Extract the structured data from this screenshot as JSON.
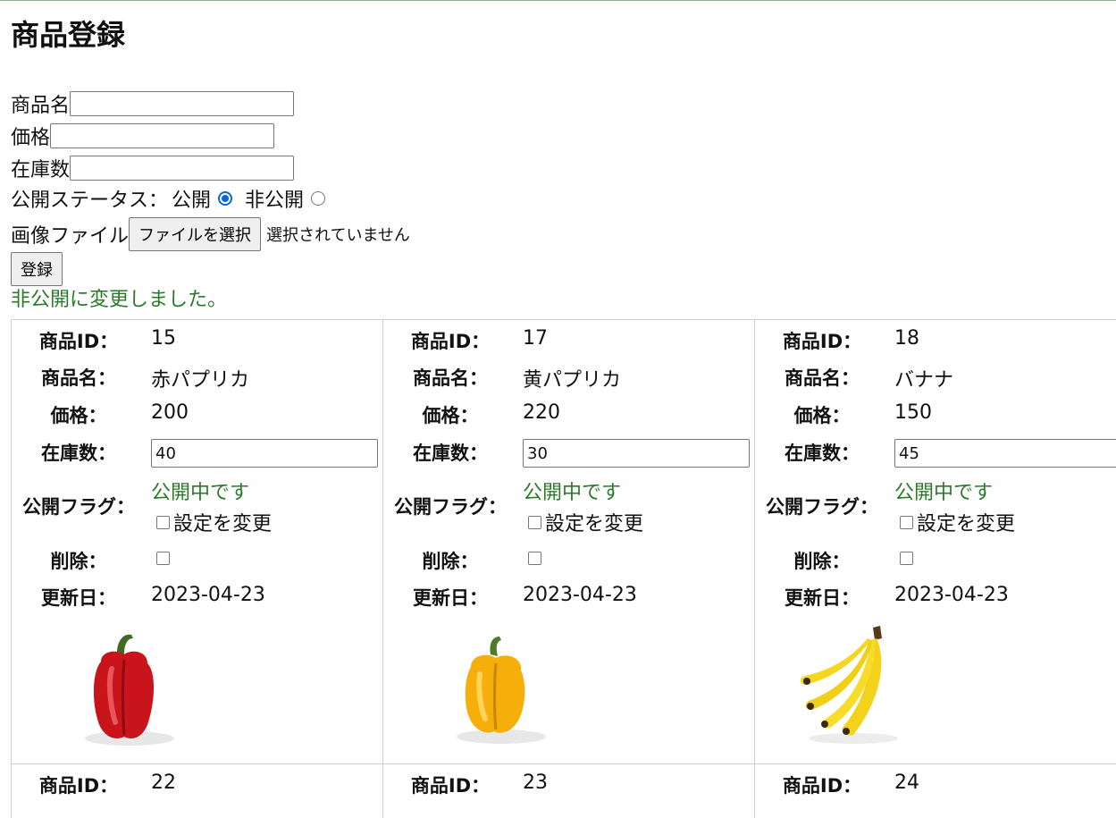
{
  "title": "商品登録",
  "form": {
    "name_label": "商品名",
    "price_label": "価格",
    "stock_label": "在庫数",
    "status_label": "公開ステータス：",
    "public_label": "公開",
    "private_label": "非公開",
    "image_label": "画像ファイル",
    "file_button": "ファイルを選択",
    "file_none": "選択されていません",
    "submit": "登録"
  },
  "message": "非公開に変更しました。",
  "labels": {
    "id": "商品ID：",
    "name": "商品名：",
    "price": "価格：",
    "stock": "在庫数：",
    "flag": "公開フラグ：",
    "delete": "削除：",
    "updated": "更新日："
  },
  "products": [
    {
      "id": "15",
      "name": "赤パプリカ",
      "price": "200",
      "stock": "40",
      "status": "公開中です",
      "change": "設定を変更",
      "updated": "2023-04-23",
      "image": "red-paprika"
    },
    {
      "id": "17",
      "name": "黄パプリカ",
      "price": "220",
      "stock": "30",
      "status": "公開中です",
      "change": "設定を変更",
      "updated": "2023-04-23",
      "image": "yellow-paprika"
    },
    {
      "id": "18",
      "name": "バナナ",
      "price": "150",
      "stock": "45",
      "status": "公開中です",
      "change": "設定を変更",
      "updated": "2023-04-23",
      "image": "banana"
    }
  ],
  "next_row_ids": [
    "22",
    "23",
    "24"
  ],
  "colors": {
    "status_green": "#2a7a2a",
    "radio_blue": "#0b66d6"
  }
}
